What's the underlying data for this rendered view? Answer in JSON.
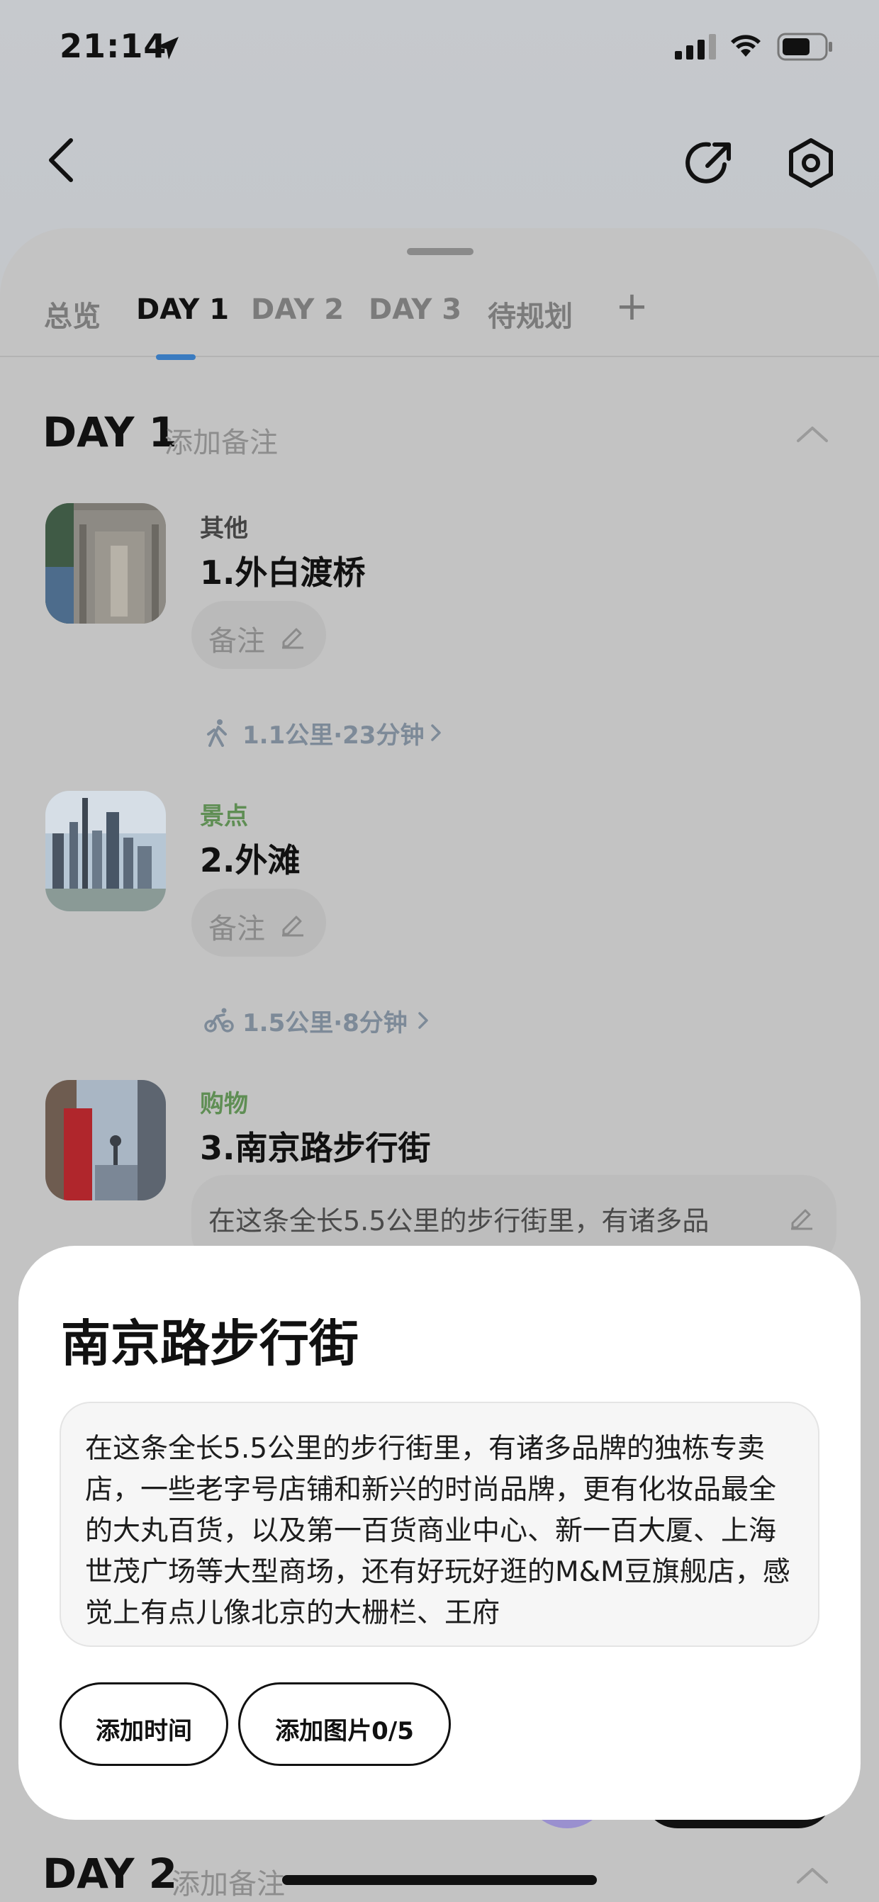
{
  "status_bar": {
    "time": "21:14"
  },
  "tabs": [
    {
      "label": "总览"
    },
    {
      "label": "DAY 1"
    },
    {
      "label": "DAY 2"
    },
    {
      "label": "DAY 3"
    },
    {
      "label": "待规划"
    },
    {
      "label": "+"
    }
  ],
  "day1": {
    "title": "DAY 1",
    "note_placeholder": "添加备注",
    "items": [
      {
        "category": "其他",
        "name": "1.外白渡桥",
        "note_label": "备注"
      },
      {
        "category": "景点",
        "name": "2.外滩",
        "note_label": "备注"
      },
      {
        "category": "购物",
        "name": "3.南京路步行街",
        "note_text": "在这条全长5.5公里的步行街里，有诸多品"
      }
    ],
    "routes": [
      {
        "mode": "walk",
        "text": "1.1公里·23分钟"
      },
      {
        "mode": "bike",
        "text": "1.5公里·8分钟"
      }
    ]
  },
  "day2": {
    "title": "DAY 2",
    "note_placeholder": "添加备注"
  },
  "detail_card": {
    "title": "南京路步行街",
    "description": "在这条全长5.5公里的步行街里，有诸多品牌的独栋专卖店，一些老字号店铺和新兴的时尚品牌，更有化妆品最全的大丸百货，以及第一百货商业中心、新一百大厦、上海世茂广场等大型商场，还有好玩好逛的M&M豆旗舰店，感觉上有点儿像北京的大栅栏、王府",
    "add_time_label": "添加时间",
    "add_photo_label": "添加图片0/5"
  },
  "colors": {
    "active_tab_indicator": "#3a7bc0",
    "category_green": "#5f8e54",
    "route_text": "#7d8a98"
  },
  "icons": [
    "location-arrow-icon",
    "signal-icon",
    "wifi-icon",
    "battery-icon",
    "back-icon",
    "share-icon",
    "settings-icon",
    "chevron-up-icon",
    "pencil-icon",
    "walk-icon",
    "bike-icon",
    "chevron-right-icon"
  ]
}
